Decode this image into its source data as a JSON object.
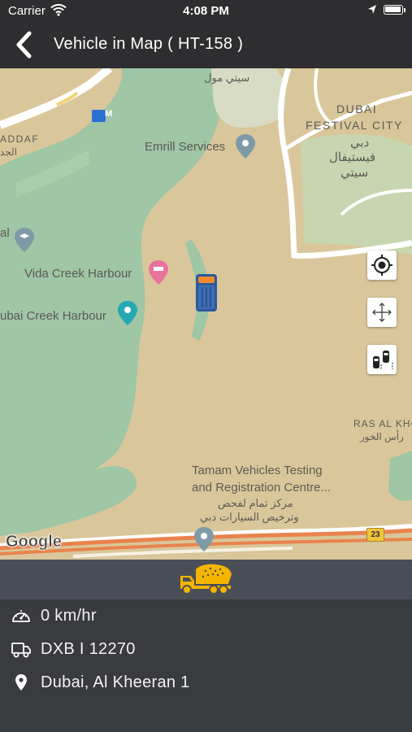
{
  "status_bar": {
    "carrier": "Carrier",
    "time": "4:08 PM"
  },
  "nav": {
    "title": "Vehicle in Map ( HT-158 )",
    "back_icon": "chevron-left-icon"
  },
  "map": {
    "labels": {
      "dubai_festival_city_en_1": "DUBAI",
      "dubai_festival_city_en_2": "FESTIVAL CITY",
      "dubai_festival_city_ar_1": "دبي",
      "dubai_festival_city_ar_2": "فيستيفال",
      "dubai_festival_city_ar_3": "سيتي",
      "city_mall_ar": "سيتي مول",
      "emrill": "Emrill Services",
      "vida": "Vida Creek Harbour",
      "dubai_creek_harbour": "ubai Creek Harbour",
      "addaf_en": "ADDAF",
      "addaf_ar": "الجد",
      "al_partial": "al",
      "ras_al_khor_en": "RAS AL KHO",
      "ras_al_khor_ar": "رأس الخور",
      "tamam_1": "Tamam Vehicles Testing",
      "tamam_2": "and Registration Centre...",
      "tamam_ar_1": "مركز تمام لفحص",
      "tamam_ar_2": "وترخيص السيارات دبي",
      "route_shield": "23",
      "google": "Google"
    },
    "metro_badge": "M",
    "controls": [
      {
        "name": "my-location-icon"
      },
      {
        "name": "fit-bounds-icon"
      },
      {
        "name": "traffic-icon"
      }
    ]
  },
  "vehicle_bar": {
    "icon": "dump-truck-icon",
    "accent": "#f5b400"
  },
  "info": {
    "speed": "0 km/hr",
    "plate": "DXB I 12270",
    "location": "Dubai, Al Kheeran 1"
  },
  "colors": {
    "navbar": "#2e2e30",
    "land": "#d9c79b",
    "water": "#9fc6a5",
    "info_bg": "#3a3b3f",
    "vehicle_bar": "#4a4f57"
  }
}
